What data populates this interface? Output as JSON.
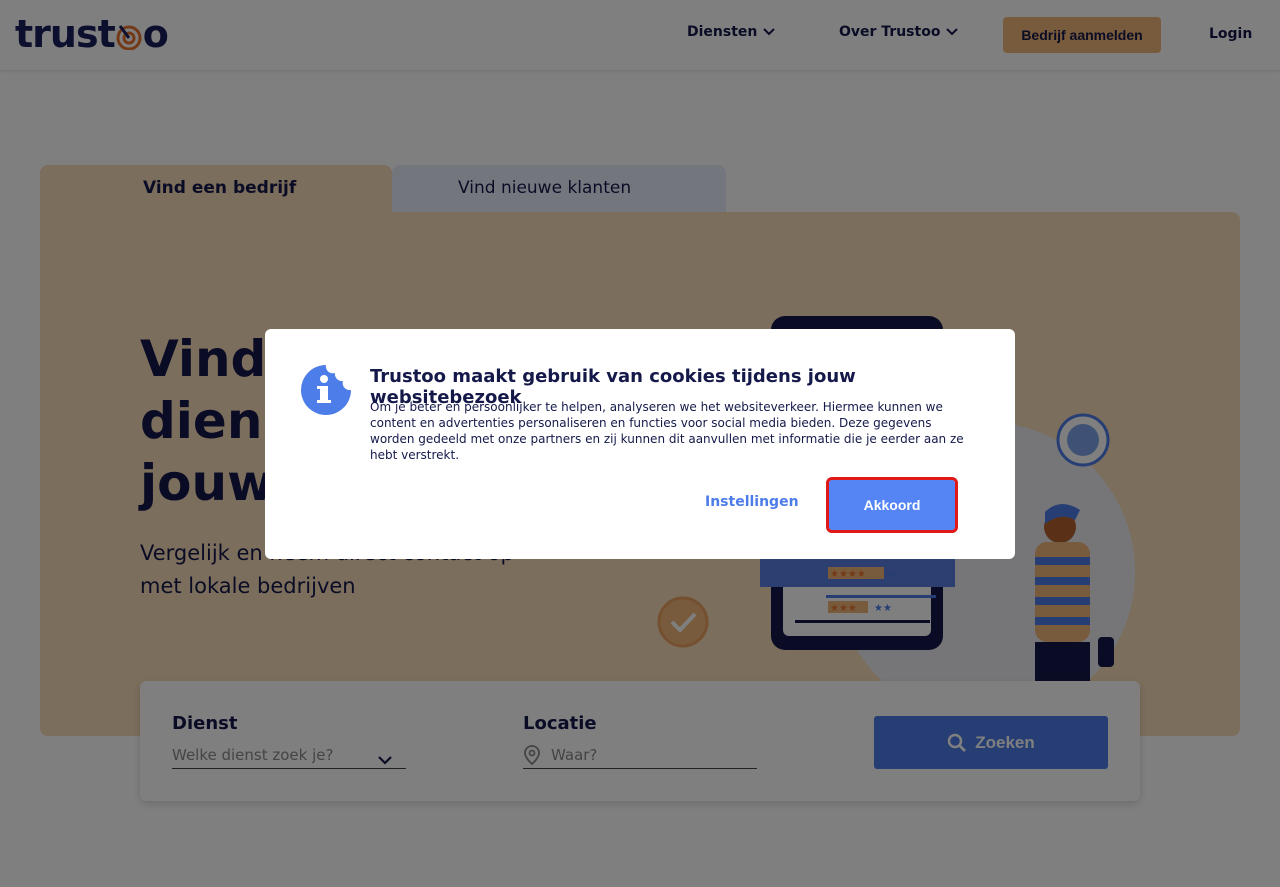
{
  "header": {
    "logo_pre": "trust",
    "logo_post": "o",
    "nav": [
      {
        "label": "Diensten"
      },
      {
        "label": "Over Trustoo"
      }
    ],
    "register_label": "Bedrijf aanmelden",
    "login_label": "Login"
  },
  "tabs": [
    {
      "label": "Vind een bedrijf",
      "active": true
    },
    {
      "label": "Vind nieuwe klanten",
      "active": false
    }
  ],
  "hero": {
    "title_line1": "Vind",
    "title_line2": "diens",
    "title_line3": "jouw",
    "subtitle_line1": "Vergelijk en neem direct contact op",
    "subtitle_line2": "met lokale bedrijven"
  },
  "search": {
    "service_label": "Dienst",
    "service_placeholder": "Welke dienst zoek je?",
    "location_label": "Locatie",
    "location_placeholder": "Waar?",
    "button_label": "Zoeken"
  },
  "cookie_dialog": {
    "title": "Trustoo maakt gebruik van cookies tijdens jouw websitebezoek",
    "text": "Om je beter en persoonlijker te helpen, analyseren we het websiteverkeer. Hiermee kunnen we content en advertenties personaliseren en functies voor social media bieden. Deze gegevens worden gedeeld met onze partners en zij kunnen dit aanvullen met informatie die je eerder aan ze hebt verstrekt.",
    "settings_label": "Instellingen",
    "accept_label": "Akkoord"
  },
  "colors": {
    "brand_navy": "#14194a",
    "accent_orange": "#f0b778",
    "hero_bg": "#f9dcb8",
    "primary_blue": "#4d7de8",
    "highlight_red": "#e01818"
  },
  "icons": [
    "chevron-down-icon",
    "target-icon",
    "search-icon",
    "location-pin-icon",
    "info-cookie-icon",
    "check-circle-icon"
  ]
}
